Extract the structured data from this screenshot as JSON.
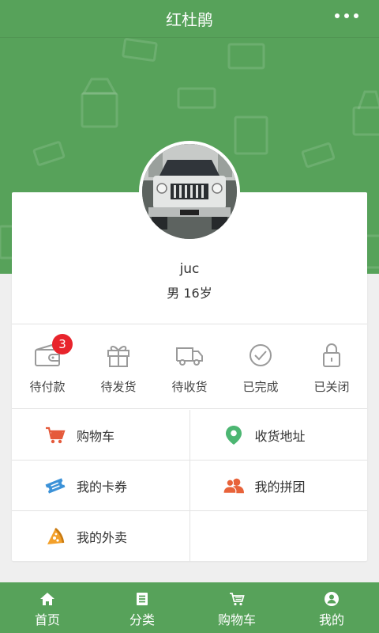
{
  "header": {
    "title": "红杜鹃",
    "more_icon": "more-dots-icon"
  },
  "colors": {
    "brand_green": "#57a25a",
    "badge_red": "#e8242c",
    "cart_red": "#e55a3b",
    "location_green": "#4cb672",
    "coupon_blue": "#3c92d8",
    "group_orange": "#e8633a",
    "takeout_orange": "#f3a02a"
  },
  "profile": {
    "name": "juc",
    "meta": "男 16岁"
  },
  "orders": [
    {
      "label": "待付款",
      "icon": "wallet-icon",
      "badge": "3"
    },
    {
      "label": "待发货",
      "icon": "gift-icon"
    },
    {
      "label": "待收货",
      "icon": "truck-icon"
    },
    {
      "label": "已完成",
      "icon": "check-circle-icon"
    },
    {
      "label": "已关闭",
      "icon": "lock-icon"
    }
  ],
  "menu": [
    {
      "label": "购物车",
      "icon": "cart-icon"
    },
    {
      "label": "收货地址",
      "icon": "location-pin-icon"
    },
    {
      "label": "我的卡券",
      "icon": "coupon-icon"
    },
    {
      "label": "我的拼团",
      "icon": "group-users-icon"
    },
    {
      "label": "我的外卖",
      "icon": "pizza-icon"
    }
  ],
  "tabs": [
    {
      "label": "首页",
      "icon": "home-icon"
    },
    {
      "label": "分类",
      "icon": "list-icon"
    },
    {
      "label": "购物车",
      "icon": "cart-icon"
    },
    {
      "label": "我的",
      "icon": "user-icon"
    }
  ]
}
